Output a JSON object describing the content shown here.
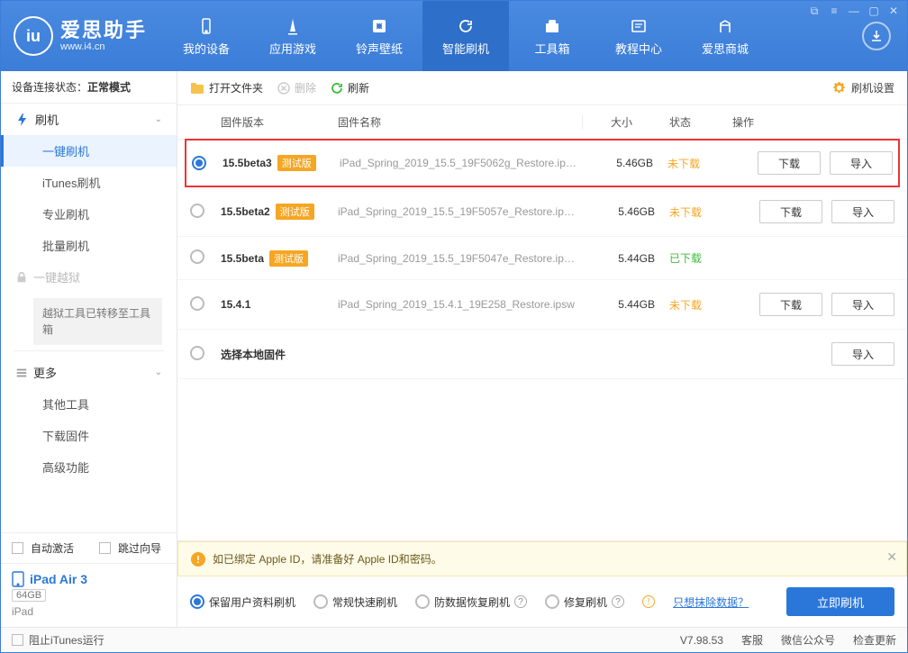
{
  "window_controls": {
    "a": "⧉",
    "b": "≡",
    "min": "—",
    "max": "▢",
    "close": "✕"
  },
  "brand": {
    "title": "爱思助手",
    "site": "www.i4.cn",
    "logo_letter": "iu"
  },
  "topnav": {
    "items": [
      "我的设备",
      "应用游戏",
      "铃声壁纸",
      "智能刷机",
      "工具箱",
      "教程中心",
      "爱思商城"
    ],
    "active_index": 3
  },
  "sidebar": {
    "status_label": "设备连接状态：",
    "status_value": "正常模式",
    "flash_group": "刷机",
    "flash_items": [
      "一键刷机",
      "iTunes刷机",
      "专业刷机",
      "批量刷机"
    ],
    "jailbreak_label": "一键越狱",
    "jailbreak_note": "越狱工具已转移至工具箱",
    "more_label": "更多",
    "more_items": [
      "其他工具",
      "下载固件",
      "高级功能"
    ],
    "auto_activate": "自动激活",
    "skip_guide": "跳过向导",
    "device": {
      "name": "iPad Air 3",
      "capacity": "64GB",
      "type": "iPad"
    }
  },
  "toolbar": {
    "open_folder": "打开文件夹",
    "delete": "删除",
    "refresh": "刷新",
    "settings": "刷机设置"
  },
  "columns": {
    "version": "固件版本",
    "name": "固件名称",
    "size": "大小",
    "status": "状态",
    "action": "操作"
  },
  "firmware": [
    {
      "version": "15.5beta3",
      "beta": true,
      "name": "iPad_Spring_2019_15.5_19F5062g_Restore.ip…",
      "size": "5.46GB",
      "status": "未下载",
      "status_class": "stat-orange",
      "download": true,
      "selected": true,
      "highlight": true
    },
    {
      "version": "15.5beta2",
      "beta": true,
      "name": "iPad_Spring_2019_15.5_19F5057e_Restore.ip…",
      "size": "5.46GB",
      "status": "未下载",
      "status_class": "stat-orange",
      "download": true,
      "selected": false
    },
    {
      "version": "15.5beta",
      "beta": true,
      "name": "iPad_Spring_2019_15.5_19F5047e_Restore.ip…",
      "size": "5.44GB",
      "status": "已下载",
      "status_class": "stat-green",
      "download": false,
      "selected": false
    },
    {
      "version": "15.4.1",
      "beta": false,
      "name": "iPad_Spring_2019_15.4.1_19E258_Restore.ipsw",
      "size": "5.44GB",
      "status": "未下载",
      "status_class": "stat-orange",
      "download": true,
      "selected": false
    }
  ],
  "local_firmware_label": "选择本地固件",
  "beta_badge": "测试版",
  "buttons": {
    "download": "下载",
    "import": "导入"
  },
  "notice": "如已绑定 Apple ID，请准备好 Apple ID和密码。",
  "flash_options": {
    "opts": [
      "保留用户资料刷机",
      "常规快速刷机",
      "防数据恢复刷机",
      "修复刷机"
    ],
    "selected_index": 0,
    "erase_link": "只想抹除数据？",
    "flash_btn": "立即刷机"
  },
  "footer": {
    "block_itunes": "阻止iTunes运行",
    "version": "V7.98.53",
    "items": [
      "客服",
      "微信公众号",
      "检查更新"
    ]
  }
}
